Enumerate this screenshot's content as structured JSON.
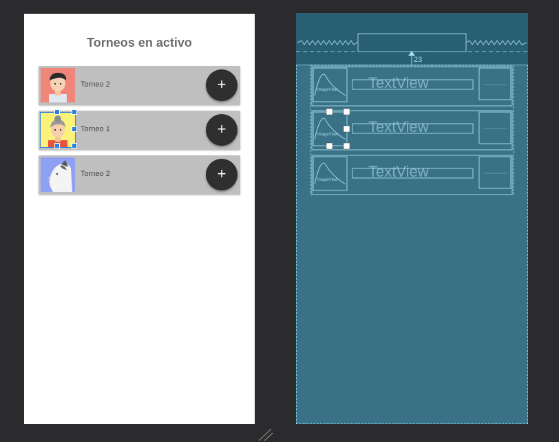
{
  "design": {
    "title": "Torneos en activo",
    "cards": [
      {
        "label": "Torneo 2",
        "avatar": "man-avatar-icon",
        "action": "+"
      },
      {
        "label": "Torneo 1",
        "avatar": "woman-avatar-icon",
        "action": "+"
      },
      {
        "label": "Torneo 2",
        "avatar": "cat-avatar-icon",
        "action": "+"
      }
    ],
    "selected_index": 1
  },
  "blueprint": {
    "margin_label": "23",
    "rows": [
      {
        "image_label": "ImageView",
        "text_label": "TextView"
      },
      {
        "image_label": "ImageView",
        "text_label": "TextView"
      },
      {
        "image_label": "ImageView",
        "text_label": "TextView"
      }
    ]
  },
  "colors": {
    "canvas": "#2b2b2d",
    "card": "#bfbfbf",
    "fab": "#2f2f2f",
    "selection": "#2a7fe0",
    "blueprint": "#3b7186",
    "blueprint_header": "#295f72"
  }
}
